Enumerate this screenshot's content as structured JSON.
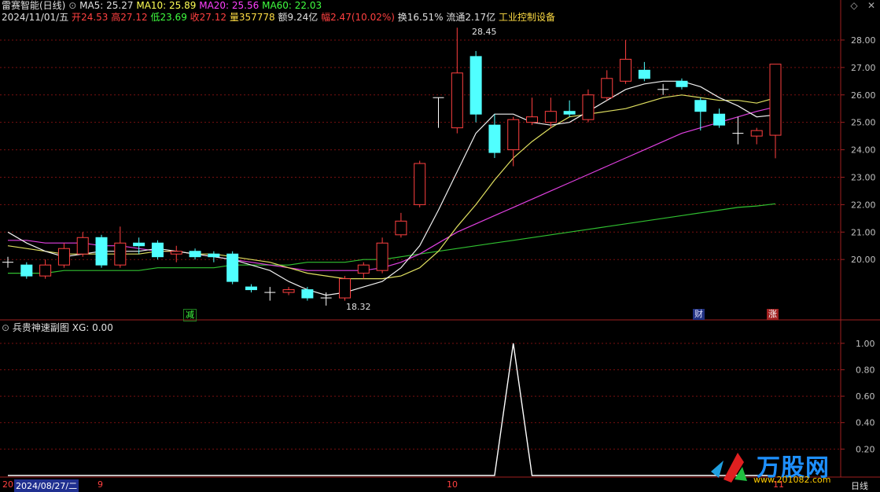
{
  "header": {
    "stock_name": "雷赛智能(日线)",
    "ma5": "MA5: 25.27",
    "ma10": "MA10: 25.89",
    "ma20": "MA20: 25.56",
    "ma60": "MA60: 22.03"
  },
  "quote": {
    "date": "2024/11/01/五",
    "open_label": "开",
    "open": "24.53",
    "high_label": "高",
    "high": "27.12",
    "low_label": "低",
    "low": "23.69",
    "close_label": "收",
    "close": "27.12",
    "vol_label": "量",
    "vol": "357778",
    "amount_label": "额",
    "amount": "9.24亿",
    "chg_label": "幅",
    "chg": "2.47(10.02%)",
    "turnover": "换16.51%",
    "float": "流通2.17亿",
    "industry": "工业控制设备"
  },
  "indicator": {
    "title": "兵贵神速副图",
    "value": "XG: 0.00"
  },
  "price_axis": [
    "28.00",
    "27.00",
    "26.00",
    "25.00",
    "24.00",
    "23.00",
    "22.00",
    "21.00",
    "20.00"
  ],
  "ind_axis": [
    "1.00",
    "0.80",
    "0.60",
    "0.40",
    "0.20"
  ],
  "annotations": {
    "high_marker": "28.45",
    "low_marker": "18.32",
    "event_jian": "减",
    "event_cai": "财",
    "event_zhang": "涨"
  },
  "bottom": {
    "date_label": "2024/08/27/二",
    "month_9": "9",
    "month_10": "10",
    "month_11": "11",
    "period": "日线",
    "left_stub": "20"
  },
  "logo": {
    "text": "万股网",
    "url": "www.201082.com"
  },
  "chart_data": {
    "type": "candlestick",
    "candles": [
      {
        "o": 19.9,
        "c": 19.9,
        "h": 20.1,
        "l": 19.7
      },
      {
        "o": 19.8,
        "c": 19.4,
        "h": 19.9,
        "l": 19.3
      },
      {
        "o": 19.4,
        "c": 19.8,
        "h": 20.0,
        "l": 19.3
      },
      {
        "o": 19.8,
        "c": 20.4,
        "h": 20.6,
        "l": 19.7
      },
      {
        "o": 20.2,
        "c": 20.8,
        "h": 21.0,
        "l": 20.1
      },
      {
        "o": 20.8,
        "c": 19.8,
        "h": 20.9,
        "l": 19.7
      },
      {
        "o": 19.8,
        "c": 20.6,
        "h": 21.2,
        "l": 19.7
      },
      {
        "o": 20.6,
        "c": 20.5,
        "h": 20.8,
        "l": 20.2
      },
      {
        "o": 20.6,
        "c": 20.1,
        "h": 20.7,
        "l": 20.0
      },
      {
        "o": 20.2,
        "c": 20.3,
        "h": 20.5,
        "l": 19.9
      },
      {
        "o": 20.3,
        "c": 20.1,
        "h": 20.4,
        "l": 20.0
      },
      {
        "o": 20.2,
        "c": 20.1,
        "h": 20.3,
        "l": 19.9
      },
      {
        "o": 20.2,
        "c": 19.2,
        "h": 20.3,
        "l": 19.1
      },
      {
        "o": 19.0,
        "c": 18.9,
        "h": 19.1,
        "l": 18.8
      },
      {
        "o": 18.8,
        "c": 18.8,
        "h": 19.0,
        "l": 18.5
      },
      {
        "o": 18.8,
        "c": 18.9,
        "h": 19.0,
        "l": 18.7
      },
      {
        "o": 18.9,
        "c": 18.6,
        "h": 19.0,
        "l": 18.5
      },
      {
        "o": 18.6,
        "c": 18.6,
        "h": 18.8,
        "l": 18.32
      },
      {
        "o": 18.6,
        "c": 19.3,
        "h": 19.4,
        "l": 18.5
      },
      {
        "o": 19.5,
        "c": 19.8,
        "h": 19.9,
        "l": 19.3
      },
      {
        "o": 19.6,
        "c": 20.6,
        "h": 20.8,
        "l": 19.5
      },
      {
        "o": 20.9,
        "c": 21.4,
        "h": 21.7,
        "l": 20.8
      },
      {
        "o": 22.0,
        "c": 23.5,
        "h": 23.6,
        "l": 21.9
      },
      {
        "o": 25.9,
        "c": 25.9,
        "h": 25.9,
        "l": 24.8
      },
      {
        "o": 24.8,
        "c": 26.8,
        "h": 28.45,
        "l": 24.6
      },
      {
        "o": 27.4,
        "c": 25.3,
        "h": 27.6,
        "l": 25.0
      },
      {
        "o": 24.9,
        "c": 23.9,
        "h": 25.3,
        "l": 23.7
      },
      {
        "o": 24.0,
        "c": 25.1,
        "h": 25.2,
        "l": 23.4
      },
      {
        "o": 25.0,
        "c": 25.2,
        "h": 25.9,
        "l": 24.9
      },
      {
        "o": 25.0,
        "c": 25.4,
        "h": 25.9,
        "l": 24.8
      },
      {
        "o": 25.4,
        "c": 25.3,
        "h": 25.8,
        "l": 25.2
      },
      {
        "o": 25.1,
        "c": 26.0,
        "h": 26.2,
        "l": 25.0
      },
      {
        "o": 25.9,
        "c": 26.6,
        "h": 26.9,
        "l": 25.8
      },
      {
        "o": 26.5,
        "c": 27.3,
        "h": 28.0,
        "l": 26.4
      },
      {
        "o": 26.9,
        "c": 26.6,
        "h": 27.2,
        "l": 26.5
      },
      {
        "o": 26.2,
        "c": 26.2,
        "h": 26.4,
        "l": 26.0
      },
      {
        "o": 26.5,
        "c": 26.3,
        "h": 26.6,
        "l": 26.2
      },
      {
        "o": 25.8,
        "c": 25.4,
        "h": 25.9,
        "l": 24.7
      },
      {
        "o": 25.3,
        "c": 24.9,
        "h": 25.5,
        "l": 24.8
      },
      {
        "o": 24.6,
        "c": 24.6,
        "h": 25.2,
        "l": 24.2
      },
      {
        "o": 24.5,
        "c": 24.7,
        "h": 24.8,
        "l": 24.2
      },
      {
        "o": 24.53,
        "c": 27.12,
        "h": 27.12,
        "l": 23.69
      }
    ],
    "ma5": [
      21.0,
      20.6,
      20.3,
      20.1,
      20.2,
      20.3,
      20.3,
      20.3,
      20.4,
      20.3,
      20.2,
      20.1,
      20.0,
      19.8,
      19.6,
      19.2,
      18.9,
      18.7,
      18.8,
      19.0,
      19.2,
      19.7,
      20.5,
      21.8,
      23.2,
      24.6,
      25.3,
      25.3,
      25.0,
      24.9,
      25.0,
      25.4,
      25.8,
      26.2,
      26.4,
      26.5,
      26.5,
      26.3,
      25.9,
      25.6,
      25.2,
      25.27
    ],
    "ma10": [
      20.5,
      20.4,
      20.3,
      20.2,
      20.2,
      20.2,
      20.2,
      20.2,
      20.3,
      20.3,
      20.2,
      20.2,
      20.1,
      20.0,
      19.9,
      19.7,
      19.5,
      19.4,
      19.3,
      19.3,
      19.3,
      19.4,
      19.7,
      20.3,
      21.2,
      22.0,
      22.9,
      23.7,
      24.3,
      24.8,
      25.2,
      25.3,
      25.4,
      25.5,
      25.7,
      25.9,
      26.0,
      25.9,
      25.8,
      25.8,
      25.7,
      25.89
    ],
    "ma20": [
      20.7,
      20.7,
      20.6,
      20.6,
      20.6,
      20.5,
      20.5,
      20.4,
      20.3,
      20.3,
      20.2,
      20.1,
      20.0,
      19.9,
      19.8,
      19.7,
      19.6,
      19.6,
      19.6,
      19.6,
      19.7,
      19.9,
      20.2,
      20.6,
      21.0,
      21.3,
      21.6,
      21.9,
      22.2,
      22.5,
      22.8,
      23.1,
      23.4,
      23.7,
      24.0,
      24.3,
      24.6,
      24.8,
      25.0,
      25.2,
      25.4,
      25.56
    ],
    "ma60": [
      19.5,
      19.5,
      19.5,
      19.6,
      19.6,
      19.6,
      19.6,
      19.6,
      19.7,
      19.7,
      19.7,
      19.7,
      19.8,
      19.8,
      19.8,
      19.8,
      19.9,
      19.9,
      19.9,
      20.0,
      20.0,
      20.1,
      20.2,
      20.3,
      20.4,
      20.5,
      20.6,
      20.7,
      20.8,
      20.9,
      21.0,
      21.1,
      21.2,
      21.3,
      21.4,
      21.5,
      21.6,
      21.7,
      21.8,
      21.9,
      21.95,
      22.03
    ],
    "xg": [
      0,
      0,
      0,
      0,
      0,
      0,
      0,
      0,
      0,
      0,
      0,
      0,
      0,
      0,
      0,
      0,
      0,
      0,
      0,
      0,
      0,
      0,
      0,
      0,
      0,
      0,
      0,
      1,
      0,
      0,
      0,
      0,
      0,
      0,
      0,
      0,
      0,
      0,
      0,
      0,
      0,
      0
    ],
    "price_range": [
      18.0,
      28.6
    ],
    "xg_range": [
      0,
      1.1
    ],
    "events": [
      {
        "index": 9,
        "text": "减"
      },
      {
        "index": 37,
        "text": "财"
      },
      {
        "index": 41,
        "text": "涨"
      }
    ]
  }
}
